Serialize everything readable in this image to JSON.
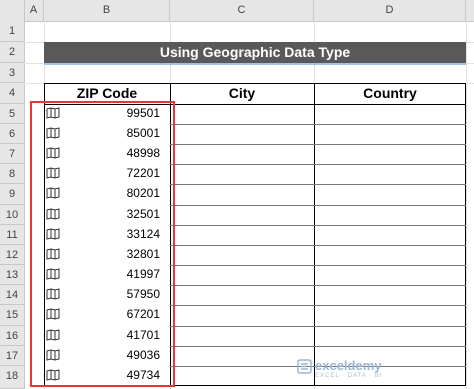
{
  "columns": [
    "A",
    "B",
    "C",
    "D"
  ],
  "rows": [
    "1",
    "2",
    "3",
    "4",
    "5",
    "6",
    "7",
    "8",
    "9",
    "10",
    "11",
    "12",
    "13",
    "14",
    "15",
    "16",
    "17",
    "18"
  ],
  "title": "Using Geographic Data Type",
  "headers": {
    "zip": "ZIP Code",
    "city": "City",
    "country": "Country"
  },
  "zip_codes": [
    "99501",
    "85001",
    "48998",
    "72201",
    "80201",
    "32501",
    "33124",
    "32801",
    "41997",
    "57950",
    "67201",
    "41701",
    "49036",
    "49734"
  ],
  "watermark": {
    "name": "exceldemy",
    "sub": "EXCEL · DATA · BI"
  },
  "colors": {
    "title_bg": "#595959",
    "highlight": "#e8343a"
  }
}
